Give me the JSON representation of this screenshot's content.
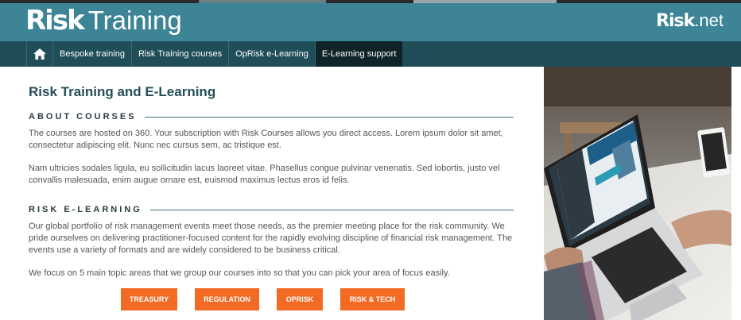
{
  "header": {
    "logo_bold": "Risk",
    "logo_light": "Training",
    "partner_bold": "Risk",
    "partner_light": ".net"
  },
  "nav": {
    "home_icon": "home-icon",
    "items": [
      {
        "label": "Bespoke training"
      },
      {
        "label": "Risk Training courses"
      },
      {
        "label": "OpRisk e-Learning"
      },
      {
        "label": "E-Learning support",
        "active": true
      }
    ]
  },
  "main": {
    "title": "Risk Training and E-Learning",
    "about": {
      "heading": "ABOUT COURSES",
      "p1": "The courses are hosted on 360. Your subscription with Risk Courses allows you direct access. Lorem ipsum dolor sit amet, consectetur adipiscing elit. Nunc nec cursus sem, ac tristique est.",
      "p2": "Nam ultricies sodales ligula, eu sollicitudin lacus laoreet vitae. Phasellus congue pulvinar venenatis. Sed lobortis, justo vel convallis malesuada, enim augue ornare est, euismod maximus lectus eros id felis."
    },
    "elearning": {
      "heading": "RISK E-LEARNING",
      "p1": "Our global portfolio of risk management events meet those needs, as the premier meeting place for the risk community. We pride ourselves on delivering practitioner-focused content for the rapidly evolving discipline of financial risk management. The events use a variety of formats and are widely considered to be business critical.",
      "p2": "We focus on 5 main topic areas that we group our courses into so that you can pick your area of focus easily."
    },
    "buttons": [
      "TREASURY",
      "REGULATION",
      "OPRISK",
      "RISK & TECH"
    ]
  },
  "colors": {
    "header": "#3c8496",
    "nav": "#1f4d58",
    "nav_active": "#0f2328",
    "title": "#244e59",
    "button": "#f26a24"
  }
}
